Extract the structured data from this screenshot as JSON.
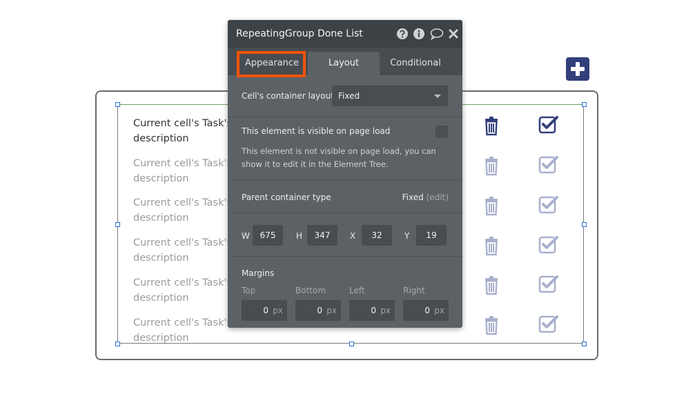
{
  "canvas": {
    "row_text": "Current cell's Task's description",
    "row_count": 6
  },
  "editor": {
    "title": "RepeatingGroup Done List",
    "header_icons": [
      "help-icon",
      "info-icon",
      "comment-icon",
      "close-icon"
    ],
    "tabs": [
      {
        "label": "Appearance",
        "active": false,
        "highlighted": true
      },
      {
        "label": "Layout",
        "active": true,
        "highlighted": false
      },
      {
        "label": "Conditional",
        "active": false,
        "highlighted": false
      }
    ],
    "cell_layout": {
      "label": "Cell's container layout",
      "value": "Fixed"
    },
    "visibility": {
      "label": "This element is visible on page load",
      "checked": false,
      "help": "This element is not visible on page load, you can show it to edit it in the Element Tree."
    },
    "parent": {
      "label": "Parent container type",
      "value": "Fixed",
      "edit": "(edit)"
    },
    "dims": {
      "w": {
        "label": "W",
        "value": "675"
      },
      "h": {
        "label": "H",
        "value": "347"
      },
      "x": {
        "label": "X",
        "value": "32"
      },
      "y": {
        "label": "Y",
        "value": "19"
      }
    },
    "margins": {
      "label": "Margins",
      "unit": "px",
      "items": [
        {
          "label": "Top",
          "value": "0"
        },
        {
          "label": "Bottom",
          "value": "0"
        },
        {
          "label": "Left",
          "value": "0"
        },
        {
          "label": "Right",
          "value": "0"
        }
      ]
    }
  },
  "colors": {
    "accent_highlight": "#f2520b",
    "brand_button": "#323f7b",
    "icon_active": "#323f7b",
    "icon_inactive": "#a9b0cc",
    "editor_bg": "#5c6166"
  }
}
